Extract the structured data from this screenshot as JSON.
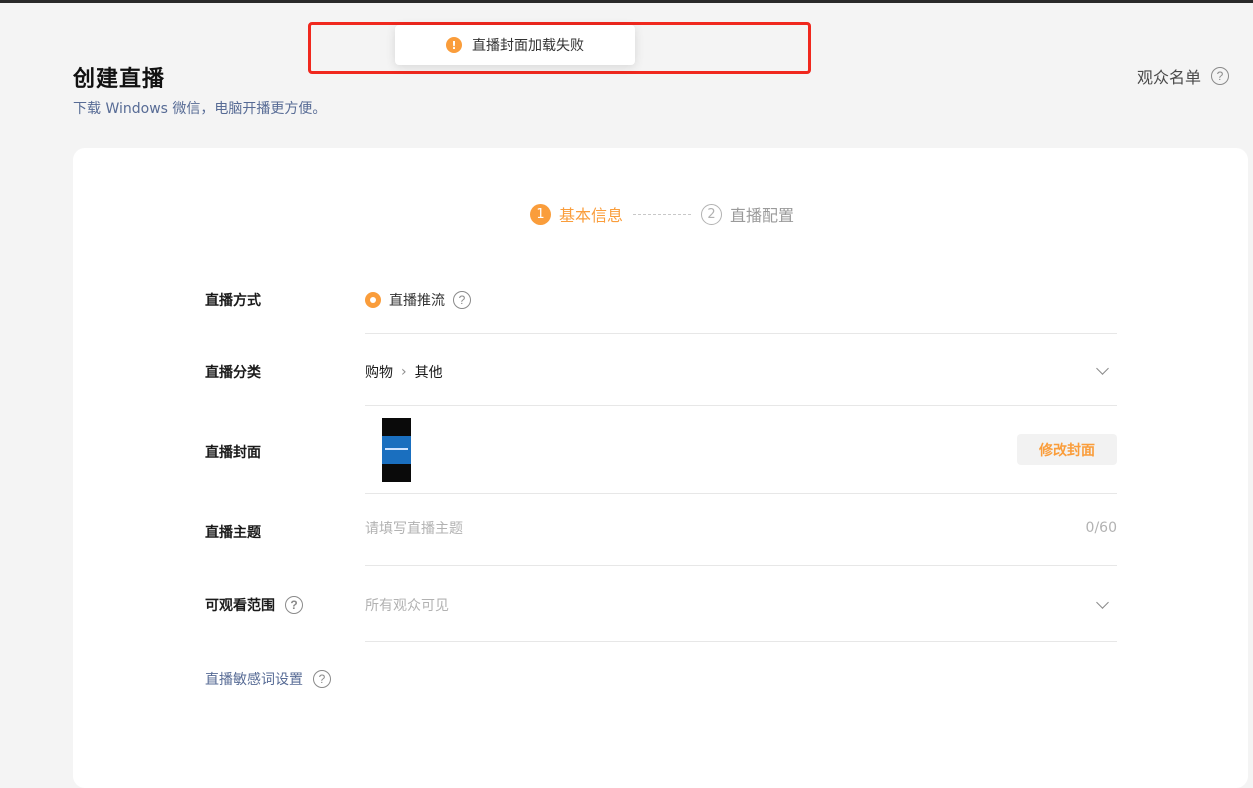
{
  "header": {
    "title": "创建直播",
    "subtitle": "下载 Windows 微信，电脑开播更方便。",
    "audience_list_label": "观众名单",
    "help_glyph": "?"
  },
  "toast": {
    "message": "直播封面加载失败",
    "icon": "warning-icon",
    "icon_glyph": "!",
    "color": "#fa9d3b",
    "highlight_color": "#f0281e"
  },
  "steps": [
    {
      "number": "1",
      "label": "基本信息",
      "active": true
    },
    {
      "number": "2",
      "label": "直播配置",
      "active": false
    }
  ],
  "form": {
    "mode": {
      "label": "直播方式",
      "option": "直播推流"
    },
    "category": {
      "label": "直播分类",
      "primary": "购物",
      "separator": "›",
      "secondary": "其他"
    },
    "cover": {
      "label": "直播封面",
      "change_button": "修改封面"
    },
    "topic": {
      "label": "直播主题",
      "placeholder": "请填写直播主题",
      "value": "",
      "counter": "0/60"
    },
    "scope": {
      "label": "可观看范围",
      "value": "所有观众可见"
    },
    "sensitive_words": {
      "label": "直播敏感词设置"
    }
  },
  "colors": {
    "accent": "#fa9d3b",
    "link": "#576b95",
    "background": "#f4f4f4"
  }
}
